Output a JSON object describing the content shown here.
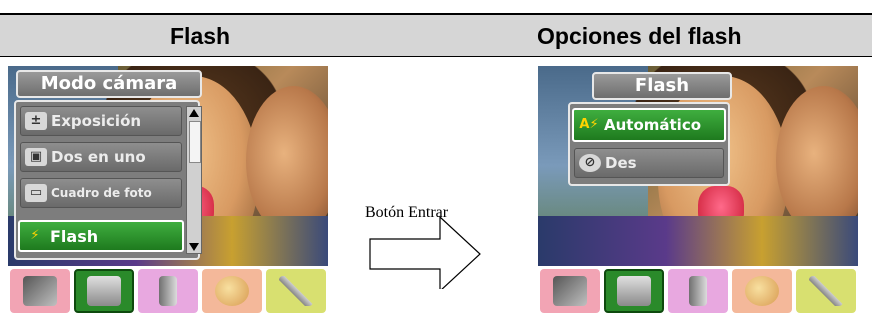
{
  "header": {
    "left_title": "Flash",
    "right_title": "Opciones del flash"
  },
  "left_screen": {
    "menu_title": "Modo cámara",
    "items": [
      {
        "label": "Exposición",
        "icon": "exposure-icon",
        "selected": false
      },
      {
        "label": "Dos en uno",
        "icon": "two-in-one-icon",
        "selected": false
      },
      {
        "label": "Cuadro de foto",
        "icon": "photo-frame-icon",
        "selected": false
      },
      {
        "label": "Flash",
        "icon": "flash-icon",
        "selected": true
      }
    ],
    "selected_tab": "camera-tab"
  },
  "right_screen": {
    "menu_title": "Flash",
    "items": [
      {
        "label": "Automático",
        "icon": "flash-auto-icon",
        "selected": true
      },
      {
        "label": "Des",
        "icon": "flash-off-icon",
        "selected": false
      }
    ],
    "selected_tab": "camera-tab"
  },
  "arrow_label": "Botón Entrar",
  "tabs": [
    {
      "name": "video-tab",
      "icon": "video-camera-icon",
      "bg": "#f2a4b4"
    },
    {
      "name": "camera-tab",
      "icon": "camera-icon",
      "bg": "#2a8a2a"
    },
    {
      "name": "voice-tab",
      "icon": "microphone-icon",
      "bg": "#e8a8e0"
    },
    {
      "name": "effects-tab",
      "icon": "palette-icon",
      "bg": "#f4b89a"
    },
    {
      "name": "settings-tab",
      "icon": "tools-icon",
      "bg": "#d8e070"
    }
  ],
  "colors": {
    "header_bg": "#d6d6d6",
    "selected_item": "#2e9a2e",
    "menu_bg": "#7d7d7d"
  }
}
